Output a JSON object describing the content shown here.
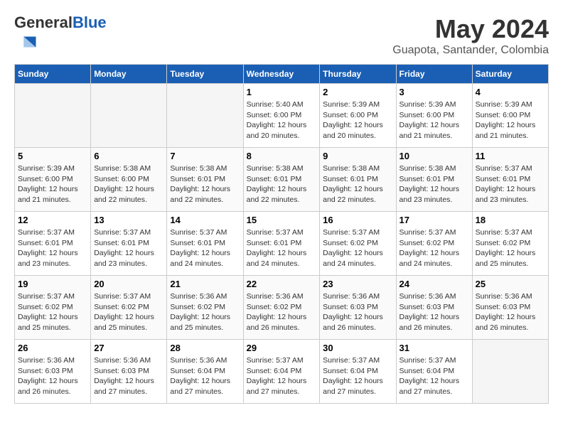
{
  "header": {
    "logo_general": "General",
    "logo_blue": "Blue",
    "month": "May 2024",
    "location": "Guapota, Santander, Colombia"
  },
  "days_of_week": [
    "Sunday",
    "Monday",
    "Tuesday",
    "Wednesday",
    "Thursday",
    "Friday",
    "Saturday"
  ],
  "weeks": [
    [
      {
        "day": "",
        "empty": true
      },
      {
        "day": "",
        "empty": true
      },
      {
        "day": "",
        "empty": true
      },
      {
        "day": "1",
        "info": "Sunrise: 5:40 AM\nSunset: 6:00 PM\nDaylight: 12 hours\nand 20 minutes."
      },
      {
        "day": "2",
        "info": "Sunrise: 5:39 AM\nSunset: 6:00 PM\nDaylight: 12 hours\nand 20 minutes."
      },
      {
        "day": "3",
        "info": "Sunrise: 5:39 AM\nSunset: 6:00 PM\nDaylight: 12 hours\nand 21 minutes."
      },
      {
        "day": "4",
        "info": "Sunrise: 5:39 AM\nSunset: 6:00 PM\nDaylight: 12 hours\nand 21 minutes."
      }
    ],
    [
      {
        "day": "5",
        "info": "Sunrise: 5:39 AM\nSunset: 6:00 PM\nDaylight: 12 hours\nand 21 minutes."
      },
      {
        "day": "6",
        "info": "Sunrise: 5:38 AM\nSunset: 6:00 PM\nDaylight: 12 hours\nand 22 minutes."
      },
      {
        "day": "7",
        "info": "Sunrise: 5:38 AM\nSunset: 6:01 PM\nDaylight: 12 hours\nand 22 minutes."
      },
      {
        "day": "8",
        "info": "Sunrise: 5:38 AM\nSunset: 6:01 PM\nDaylight: 12 hours\nand 22 minutes."
      },
      {
        "day": "9",
        "info": "Sunrise: 5:38 AM\nSunset: 6:01 PM\nDaylight: 12 hours\nand 22 minutes."
      },
      {
        "day": "10",
        "info": "Sunrise: 5:38 AM\nSunset: 6:01 PM\nDaylight: 12 hours\nand 23 minutes."
      },
      {
        "day": "11",
        "info": "Sunrise: 5:37 AM\nSunset: 6:01 PM\nDaylight: 12 hours\nand 23 minutes."
      }
    ],
    [
      {
        "day": "12",
        "info": "Sunrise: 5:37 AM\nSunset: 6:01 PM\nDaylight: 12 hours\nand 23 minutes."
      },
      {
        "day": "13",
        "info": "Sunrise: 5:37 AM\nSunset: 6:01 PM\nDaylight: 12 hours\nand 23 minutes."
      },
      {
        "day": "14",
        "info": "Sunrise: 5:37 AM\nSunset: 6:01 PM\nDaylight: 12 hours\nand 24 minutes."
      },
      {
        "day": "15",
        "info": "Sunrise: 5:37 AM\nSunset: 6:01 PM\nDaylight: 12 hours\nand 24 minutes."
      },
      {
        "day": "16",
        "info": "Sunrise: 5:37 AM\nSunset: 6:02 PM\nDaylight: 12 hours\nand 24 minutes."
      },
      {
        "day": "17",
        "info": "Sunrise: 5:37 AM\nSunset: 6:02 PM\nDaylight: 12 hours\nand 24 minutes."
      },
      {
        "day": "18",
        "info": "Sunrise: 5:37 AM\nSunset: 6:02 PM\nDaylight: 12 hours\nand 25 minutes."
      }
    ],
    [
      {
        "day": "19",
        "info": "Sunrise: 5:37 AM\nSunset: 6:02 PM\nDaylight: 12 hours\nand 25 minutes."
      },
      {
        "day": "20",
        "info": "Sunrise: 5:37 AM\nSunset: 6:02 PM\nDaylight: 12 hours\nand 25 minutes."
      },
      {
        "day": "21",
        "info": "Sunrise: 5:36 AM\nSunset: 6:02 PM\nDaylight: 12 hours\nand 25 minutes."
      },
      {
        "day": "22",
        "info": "Sunrise: 5:36 AM\nSunset: 6:02 PM\nDaylight: 12 hours\nand 26 minutes."
      },
      {
        "day": "23",
        "info": "Sunrise: 5:36 AM\nSunset: 6:03 PM\nDaylight: 12 hours\nand 26 minutes."
      },
      {
        "day": "24",
        "info": "Sunrise: 5:36 AM\nSunset: 6:03 PM\nDaylight: 12 hours\nand 26 minutes."
      },
      {
        "day": "25",
        "info": "Sunrise: 5:36 AM\nSunset: 6:03 PM\nDaylight: 12 hours\nand 26 minutes."
      }
    ],
    [
      {
        "day": "26",
        "info": "Sunrise: 5:36 AM\nSunset: 6:03 PM\nDaylight: 12 hours\nand 26 minutes."
      },
      {
        "day": "27",
        "info": "Sunrise: 5:36 AM\nSunset: 6:03 PM\nDaylight: 12 hours\nand 27 minutes."
      },
      {
        "day": "28",
        "info": "Sunrise: 5:36 AM\nSunset: 6:04 PM\nDaylight: 12 hours\nand 27 minutes."
      },
      {
        "day": "29",
        "info": "Sunrise: 5:37 AM\nSunset: 6:04 PM\nDaylight: 12 hours\nand 27 minutes."
      },
      {
        "day": "30",
        "info": "Sunrise: 5:37 AM\nSunset: 6:04 PM\nDaylight: 12 hours\nand 27 minutes."
      },
      {
        "day": "31",
        "info": "Sunrise: 5:37 AM\nSunset: 6:04 PM\nDaylight: 12 hours\nand 27 minutes."
      },
      {
        "day": "",
        "empty": true
      }
    ]
  ]
}
